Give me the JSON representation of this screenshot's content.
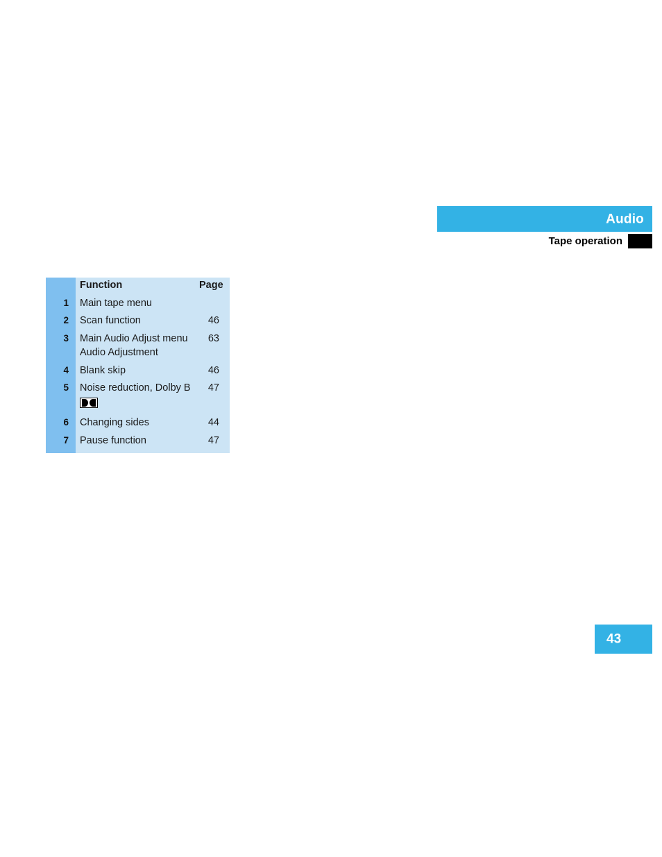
{
  "header": {
    "section_title": "Audio",
    "sub_title": "Tape operation",
    "bar_color": "#33b2e5",
    "tab_marker_color": "#000000"
  },
  "legend": {
    "columns": {
      "number": "",
      "function": "Function",
      "page": "Page"
    },
    "rows": [
      {
        "number": "1",
        "function": "Main tape menu",
        "function_line2": "",
        "page": "",
        "icon": ""
      },
      {
        "number": "2",
        "function": "Scan function",
        "function_line2": "",
        "page": "46",
        "icon": ""
      },
      {
        "number": "3",
        "function": "Main Audio Adjust menu",
        "function_line2": "Audio Adjustment",
        "page": "63",
        "icon": ""
      },
      {
        "number": "4",
        "function": "Blank skip",
        "function_line2": "",
        "page": "46",
        "icon": ""
      },
      {
        "number": "5",
        "function": "Noise reduction, Dolby B",
        "function_line2": "",
        "page": "47",
        "icon": "dolby-double-d-icon"
      },
      {
        "number": "6",
        "function": "Changing sides",
        "function_line2": "",
        "page": "44",
        "icon": ""
      },
      {
        "number": "7",
        "function": "Pause function",
        "function_line2": "",
        "page": "47",
        "icon": ""
      }
    ],
    "number_column_color": "#7fbfef",
    "body_color": "#cce4f5"
  },
  "footer": {
    "page_number": "43",
    "badge_color": "#33b2e5"
  }
}
